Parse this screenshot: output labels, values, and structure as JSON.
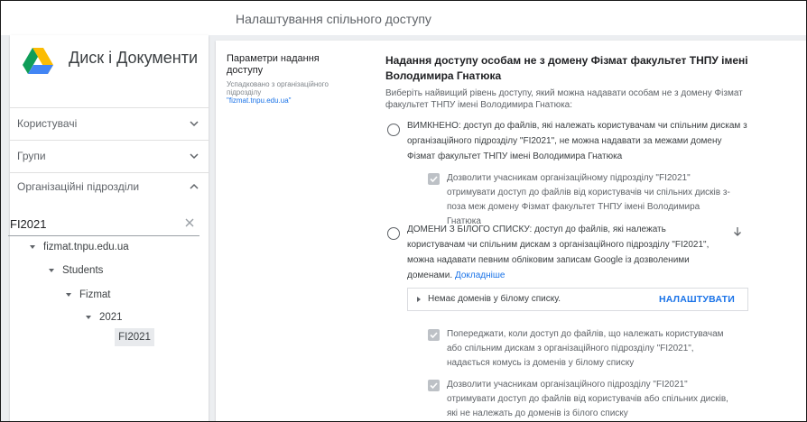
{
  "header": {
    "title": "Налаштування спільного доступу"
  },
  "app": {
    "title": "Диск і Документи"
  },
  "nav": {
    "items": [
      {
        "label": "Користувачі",
        "expanded": false
      },
      {
        "label": "Групи",
        "expanded": false
      },
      {
        "label": "Організаційні підрозділи",
        "expanded": true
      }
    ]
  },
  "search": {
    "value": "FI2021"
  },
  "tree": {
    "items": [
      {
        "label": "fizmat.tnpu.edu.ua"
      },
      {
        "label": "Students"
      },
      {
        "label": "Fizmat"
      },
      {
        "label": "2021"
      }
    ],
    "selected": "FI2021"
  },
  "params": {
    "title": "Параметри надання доступу",
    "inherited": "Успадковано з організаційного підрозділу",
    "ou": "\"fizmat.tnpu.edu.ua\""
  },
  "main": {
    "heading": "Надання доступу особам не з домену Фізмат факультет ТНПУ імені Володимира Гнатюка",
    "description": "Виберіть найвищий рівень доступу, який можна надавати особам не з домену Фізмат факультет ТНПУ імені Володимира Гнатюка:",
    "option_off": "ВИМКНЕНО: доступ до файлів, які належать користувачам чи спільним дискам з організаційного підрозділу \"FI2021\", не можна надавати за межами домену Фізмат факультет ТНПУ імені Володимира Гнатюка",
    "checkbox_off": "Дозволити учасникам організаційному підрозділу \"FI2021\" отримувати доступ до файлів від користувачів чи спільних дисків з-поза меж домену Фізмат факультет ТНПУ імені Володимира Гнатюка",
    "option_whitelist": "ДОМЕНИ З БІЛОГО СПИСКУ: доступ до файлів, які належать користувачам чи спільним дискам з організаційного підрозділу \"FI2021\", можна надавати певним обліковим записам Google із дозволеними доменами.",
    "learn_more": "Докладніше",
    "whitelist_empty": "Немає доменів у білому списку.",
    "configure_button": "НАЛАШТУВАТИ",
    "checkbox_warn": "Попереджати, коли доступ до файлів, що належать користувачам або спільним дискам з організаційного підрозділу \"FI2021\", надається комусь із доменів у білому списку",
    "checkbox_allow_whitelist": "Дозволити учасникам організаційного підрозділу \"FI2021\" отримувати доступ до файлів від користувачів або спільних дисків, які не належать до доменів із білого списку"
  },
  "colors": {
    "accent": "#1a73e8",
    "checkbox_disabled": "#bdc1c6",
    "background": "#eceef1"
  },
  "icons": {
    "logo": "google-drive-icon",
    "chevron_down": "chevron-down-icon",
    "chevron_up": "chevron-up-icon",
    "clear": "close-icon",
    "scroll_down": "arrow-down-icon"
  }
}
